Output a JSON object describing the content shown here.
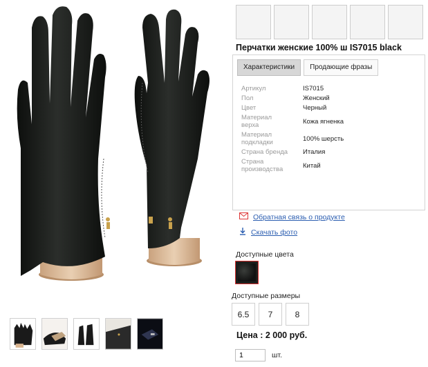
{
  "product": {
    "title": "Перчатки женские 100% ш IS7015 black"
  },
  "tabs": [
    {
      "label": "Характеристики",
      "active": true
    },
    {
      "label": "Продающие фразы",
      "active": false
    }
  ],
  "properties": [
    {
      "key": "Артикул",
      "value": "IS7015"
    },
    {
      "key": "Пол",
      "value": "Женский"
    },
    {
      "key": "Цвет",
      "value": "Черный"
    },
    {
      "key": "Материал верха",
      "value": "Кожа ягненка"
    },
    {
      "key": "Материал подкладки",
      "value": "100% шерсть"
    },
    {
      "key": "Страна бренда",
      "value": "Италия"
    },
    {
      "key": "Страна производства",
      "value": "Китай"
    }
  ],
  "links": {
    "feedback": "Обратная связь о продукте",
    "download": "Скачать фото"
  },
  "colors": {
    "label": "Доступные цвета",
    "selected_color": "#1d1f1d",
    "selected_border": "#dd3333"
  },
  "sizes": {
    "label": "Доступные размеры",
    "options": [
      "6.5",
      "7",
      "8"
    ]
  },
  "price": {
    "text": "Цена : 2 000 руб."
  },
  "quantity": {
    "value": "1",
    "unit": "шт."
  },
  "icons": {
    "feedback": "envelope-icon",
    "download": "download-arrow-icon"
  },
  "colors_palette": {
    "link": "#2a5db0",
    "active_tab": "#d7d7d7",
    "label_gray": "#9a9a9a"
  }
}
